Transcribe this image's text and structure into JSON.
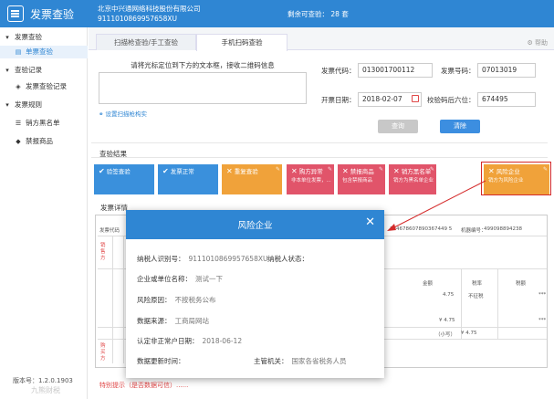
{
  "app": {
    "title": "发票查验"
  },
  "header": {
    "company_name": "北京中兴通网络科技股份有限公司",
    "company_tax_id": "9111010869957658XU",
    "quota_label": "剩余可查验：",
    "quota_value": "28 套"
  },
  "sidebar": {
    "items": [
      {
        "label": "发票查验",
        "type": "group",
        "icon": "caret-down"
      },
      {
        "label": "单票查验",
        "type": "sub",
        "icon": "file-icon",
        "active": true
      },
      {
        "label": "查验记录",
        "type": "group",
        "icon": "caret-down"
      },
      {
        "label": "发票查验记录",
        "type": "sub",
        "icon": "layers-icon"
      },
      {
        "label": "发票规则",
        "type": "group",
        "icon": "caret-down"
      },
      {
        "label": "销方黑名单",
        "type": "sub",
        "icon": "list-icon"
      },
      {
        "label": "禁报商品",
        "type": "sub",
        "icon": "box-icon"
      }
    ],
    "version": "版本号：1.2.0.1903"
  },
  "tabs": [
    {
      "label": "扫描枪查验/手工查验",
      "active": false
    },
    {
      "label": "手机扫码查验",
      "active": true
    }
  ],
  "help_label": "帮助",
  "scan": {
    "hint": "请将光标定位到下方的文本框，接收二维码信息",
    "scanner_link": "设置扫描枪构实"
  },
  "form": {
    "code_label": "发票代码：",
    "code_value": "013001700112",
    "number_label": "发票号码：",
    "number_value": "07013019",
    "date_label": "开票日期：",
    "date_value": "2018-02-07",
    "check_label": "校验码后六位：",
    "check_value": "674495",
    "query_button": "查询",
    "clear_button": "清除"
  },
  "results": {
    "title": "查验结果",
    "items": [
      {
        "label": "验签查验",
        "sub": "",
        "color": "blue",
        "mark": "✔"
      },
      {
        "label": "发票正常",
        "sub": "",
        "color": "blue",
        "mark": "✔"
      },
      {
        "label": "重复查验",
        "sub": "",
        "color": "orange",
        "mark": "✕"
      },
      {
        "label": "购方异常",
        "sub": "非本单位发票，...",
        "color": "red",
        "mark": "✕"
      },
      {
        "label": "禁报商品",
        "sub": "包含禁报商品",
        "color": "red",
        "mark": "✕"
      },
      {
        "label": "销方黑名单",
        "sub": "销方为黑名单企业",
        "color": "red",
        "mark": "✕"
      },
      {
        "label": "风险企业",
        "sub": "销方为风险企业",
        "color": "orange",
        "mark": "✕"
      }
    ]
  },
  "detail": {
    "title": "发票详情",
    "invoice_code_label": "发票代码",
    "machine_number": "124678607890367449 5",
    "check_code_label": "机器编号：",
    "check_code_value": "499098894238",
    "seller_col": "销售方",
    "buyer_col": "购买方",
    "amount_header": "金额",
    "tax_rate_header": "税率",
    "tax_header": "税额",
    "amount_value": "4.75",
    "tax_rate_value": "不征税",
    "tax_value": "***",
    "total_amount": "¥ 4.75",
    "total_tax": "***",
    "total_label": "（小写）",
    "total_value": "¥ 4.75"
  },
  "footer_note": "特别提示（是否数据可信）......",
  "watermark": "九熊财税",
  "modal": {
    "title": "风险企业",
    "tax_id_label": "纳税人识别号：",
    "tax_id_value": "9111010869957658XU",
    "tax_status_label": "纳税人状态：",
    "tax_status_value": "",
    "company_label": "企业或单位名称：",
    "company_value": "测试一下",
    "reason_label": "风险原因：",
    "reason_value": "不按税务公布",
    "source_label": "数据来源：",
    "source_value": "工商局网站",
    "identified_label": "认定非正常户日期：",
    "identified_value": "2018-06-12",
    "updated_label": "数据更新时间：",
    "updated_value": "",
    "authority_label": "主管机关：",
    "authority_value": "国家各省税务人员"
  }
}
